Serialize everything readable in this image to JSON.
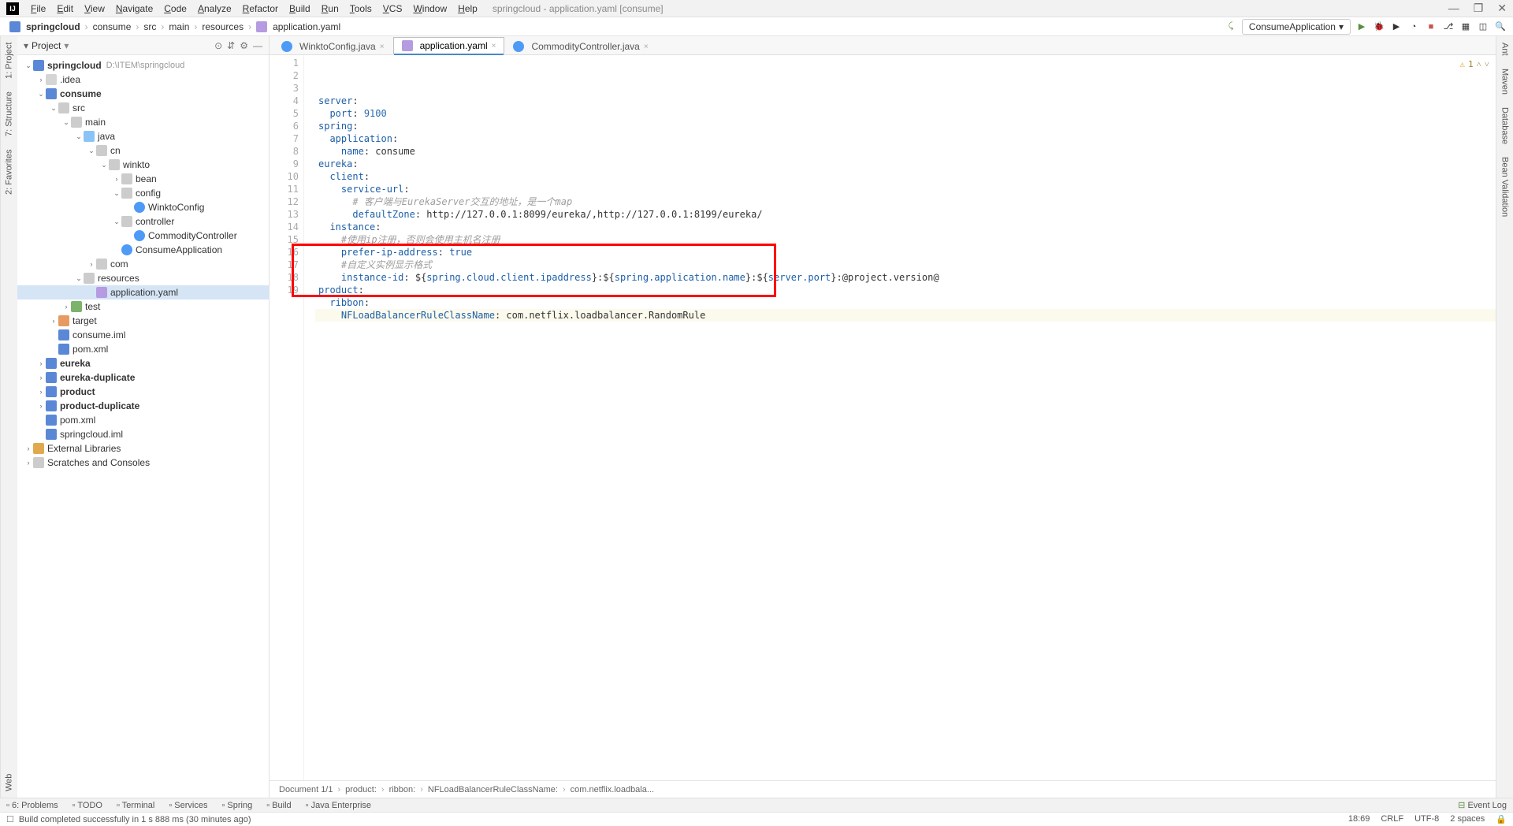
{
  "title": "springcloud - application.yaml [consume]",
  "menu": [
    "File",
    "Edit",
    "View",
    "Navigate",
    "Code",
    "Analyze",
    "Refactor",
    "Build",
    "Run",
    "Tools",
    "VCS",
    "Window",
    "Help"
  ],
  "breadcrumb": [
    "springcloud",
    "consume",
    "src",
    "main",
    "resources",
    "application.yaml"
  ],
  "runConfig": "ConsumeApplication",
  "projectPanel": {
    "title": "Project"
  },
  "tree": [
    {
      "d": 0,
      "ico": "module",
      "label": "springcloud",
      "hint": "D:\\ITEM\\springcloud",
      "bold": true,
      "exp": true
    },
    {
      "d": 1,
      "ico": "dir",
      "label": ".idea",
      "exp": false,
      "leaf": false
    },
    {
      "d": 1,
      "ico": "module",
      "label": "consume",
      "bold": true,
      "exp": true
    },
    {
      "d": 2,
      "ico": "folder",
      "label": "src",
      "exp": true
    },
    {
      "d": 3,
      "ico": "folder",
      "label": "main",
      "exp": true
    },
    {
      "d": 4,
      "ico": "folder-src",
      "label": "java",
      "exp": true
    },
    {
      "d": 5,
      "ico": "folder",
      "label": "cn",
      "exp": true
    },
    {
      "d": 6,
      "ico": "folder",
      "label": "winkto",
      "exp": true
    },
    {
      "d": 7,
      "ico": "folder",
      "label": "bean",
      "exp": false,
      "leaf": false
    },
    {
      "d": 7,
      "ico": "folder",
      "label": "config",
      "exp": true
    },
    {
      "d": 8,
      "ico": "classf",
      "label": "WinktoConfig",
      "leaf": true
    },
    {
      "d": 7,
      "ico": "folder",
      "label": "controller",
      "exp": true
    },
    {
      "d": 8,
      "ico": "classf",
      "label": "CommodityController",
      "leaf": true
    },
    {
      "d": 7,
      "ico": "classf",
      "label": "ConsumeApplication",
      "leaf": true
    },
    {
      "d": 5,
      "ico": "folder",
      "label": "com",
      "exp": false,
      "leaf": false
    },
    {
      "d": 4,
      "ico": "folder",
      "label": "resources",
      "exp": true
    },
    {
      "d": 5,
      "ico": "yaml",
      "label": "application.yaml",
      "leaf": true,
      "sel": true
    },
    {
      "d": 3,
      "ico": "folder-test",
      "label": "test",
      "exp": false,
      "leaf": false
    },
    {
      "d": 2,
      "ico": "folder-out",
      "label": "target",
      "exp": false,
      "leaf": false
    },
    {
      "d": 2,
      "ico": "module",
      "label": "consume.iml",
      "leaf": true
    },
    {
      "d": 2,
      "ico": "module",
      "label": "pom.xml",
      "leaf": true
    },
    {
      "d": 1,
      "ico": "module",
      "label": "eureka",
      "bold": true,
      "exp": false,
      "leaf": false
    },
    {
      "d": 1,
      "ico": "module",
      "label": "eureka-duplicate",
      "bold": true,
      "exp": false,
      "leaf": false
    },
    {
      "d": 1,
      "ico": "module",
      "label": "product",
      "bold": true,
      "exp": false,
      "leaf": false
    },
    {
      "d": 1,
      "ico": "module",
      "label": "product-duplicate",
      "bold": true,
      "exp": false,
      "leaf": false
    },
    {
      "d": 1,
      "ico": "module",
      "label": "pom.xml",
      "leaf": true
    },
    {
      "d": 1,
      "ico": "module",
      "label": "springcloud.iml",
      "leaf": true
    },
    {
      "d": 0,
      "ico": "lib",
      "label": "External Libraries",
      "exp": false,
      "leaf": false
    },
    {
      "d": 0,
      "ico": "folder",
      "label": "Scratches and Consoles",
      "exp": false,
      "leaf": false
    }
  ],
  "tabs": [
    {
      "label": "WinktoConfig.java",
      "ico": "classf"
    },
    {
      "label": "application.yaml",
      "ico": "yaml",
      "active": true
    },
    {
      "label": "CommodityController.java",
      "ico": "classf"
    }
  ],
  "warnings": {
    "count": "1"
  },
  "code": [
    {
      "n": 1,
      "tokens": [
        [
          "server",
          "kw"
        ],
        [
          ":",
          ""
        ]
      ]
    },
    {
      "n": 2,
      "tokens": [
        [
          "  ",
          ""
        ],
        [
          "port",
          "kw"
        ],
        [
          ": ",
          ""
        ],
        [
          "9100",
          "num"
        ]
      ]
    },
    {
      "n": 3,
      "tokens": [
        [
          "spring",
          "kw"
        ],
        [
          ":",
          ""
        ]
      ]
    },
    {
      "n": 4,
      "tokens": [
        [
          "  ",
          ""
        ],
        [
          "application",
          "kw"
        ],
        [
          ":",
          ""
        ]
      ]
    },
    {
      "n": 5,
      "tokens": [
        [
          "    ",
          ""
        ],
        [
          "name",
          "kw"
        ],
        [
          ": consume",
          ""
        ]
      ]
    },
    {
      "n": 6,
      "tokens": [
        [
          "eureka",
          "kw"
        ],
        [
          ":",
          ""
        ]
      ]
    },
    {
      "n": 7,
      "tokens": [
        [
          "  ",
          ""
        ],
        [
          "client",
          "kw"
        ],
        [
          ":",
          ""
        ]
      ]
    },
    {
      "n": 8,
      "tokens": [
        [
          "    ",
          ""
        ],
        [
          "service-url",
          "kw"
        ],
        [
          ":",
          ""
        ]
      ]
    },
    {
      "n": 9,
      "tokens": [
        [
          "      ",
          ""
        ],
        [
          "# 客户端与EurekaServer交互的地址，是一个map",
          "cmt"
        ]
      ]
    },
    {
      "n": 10,
      "tokens": [
        [
          "      ",
          ""
        ],
        [
          "defaultZone",
          "kw"
        ],
        [
          ": http://127.0.0.1:8099/eureka/,http://127.0.0.1:8199/eureka/",
          ""
        ]
      ]
    },
    {
      "n": 11,
      "tokens": [
        [
          "  ",
          ""
        ],
        [
          "instance",
          "kw"
        ],
        [
          ":",
          ""
        ]
      ]
    },
    {
      "n": 12,
      "tokens": [
        [
          "    ",
          ""
        ],
        [
          "#使用ip注册，否则会使用主机名注册",
          "cmt"
        ]
      ]
    },
    {
      "n": 13,
      "tokens": [
        [
          "    ",
          ""
        ],
        [
          "prefer-ip-address",
          "kw"
        ],
        [
          ": ",
          ""
        ],
        [
          "true",
          "kw"
        ]
      ]
    },
    {
      "n": 14,
      "tokens": [
        [
          "    ",
          ""
        ],
        [
          "#自定义实例显示格式",
          "cmt"
        ]
      ]
    },
    {
      "n": 15,
      "tokens": [
        [
          "    ",
          ""
        ],
        [
          "instance-id",
          "kw"
        ],
        [
          ": ${",
          ""
        ],
        [
          "spring.cloud.client.ipaddress",
          "var"
        ],
        [
          "}:${",
          ""
        ],
        [
          "spring.application.name",
          "var"
        ],
        [
          "}:${",
          ""
        ],
        [
          "server.port",
          "var"
        ],
        [
          "}:@project.version@",
          ""
        ]
      ]
    },
    {
      "n": 16,
      "tokens": [
        [
          "product",
          "kw"
        ],
        [
          ":",
          ""
        ]
      ]
    },
    {
      "n": 17,
      "tokens": [
        [
          "  ",
          ""
        ],
        [
          "ribbon",
          "kw"
        ],
        [
          ":",
          ""
        ]
      ]
    },
    {
      "n": 18,
      "tokens": [
        [
          "    ",
          ""
        ],
        [
          "NFLoadBalancerRuleClassName",
          "kw"
        ],
        [
          ": com.netflix.loadbalancer.RandomRule",
          ""
        ]
      ],
      "curr": true
    },
    {
      "n": 19,
      "tokens": [
        [
          "",
          ""
        ]
      ]
    }
  ],
  "editorCrumbs": [
    "Document 1/1",
    "product:",
    "ribbon:",
    "NFLoadBalancerRuleClassName:",
    "com.netflix.loadbala..."
  ],
  "bottomTabs": [
    "6: Problems",
    "TODO",
    "Terminal",
    "Services",
    "Spring",
    "Build",
    "Java Enterprise"
  ],
  "eventLog": "Event Log",
  "status": {
    "msg": "Build completed successfully in 1 s 888 ms (30 minutes ago)",
    "pos": "18:69",
    "eol": "CRLF",
    "enc": "UTF-8",
    "indent": "2 spaces"
  },
  "leftRail": [
    "2: Favorites",
    "7: Structure",
    "1: Project"
  ],
  "rightRail": [
    "Ant",
    "Maven",
    "Database",
    "Bean Validation"
  ],
  "rightRailBottom": "Web"
}
